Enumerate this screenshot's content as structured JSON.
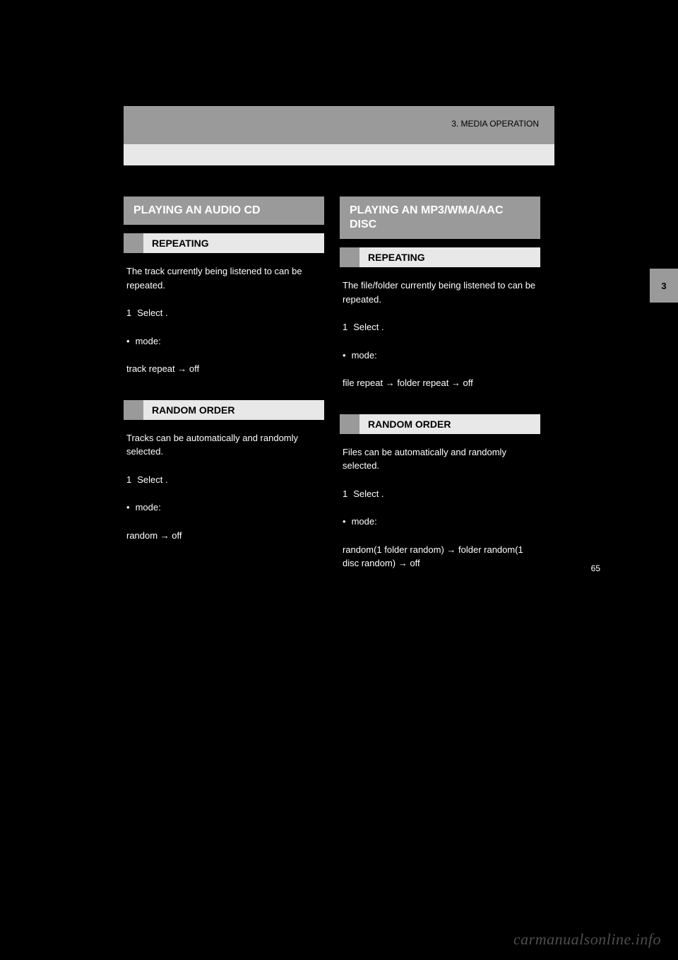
{
  "breadcrumb": "3. MEDIA OPERATION",
  "side_tab": "3",
  "page_number": "65",
  "left": {
    "title": "PLAYING AN AUDIO CD",
    "repeat": {
      "heading": "REPEATING",
      "lead": "The track currently being listened to can be repeated.",
      "item": "Select       .",
      "mode_label": "mode:",
      "mode_value": "track repeat → off"
    },
    "random": {
      "heading": "RANDOM ORDER",
      "lead": "Tracks can be automatically and randomly selected.",
      "item": "Select       .",
      "mode_label": "mode:",
      "mode_value": "random → off"
    }
  },
  "right": {
    "title": "PLAYING AN MP3/WMA/AAC DISC",
    "repeat": {
      "heading": "REPEATING",
      "lead": "The file/folder currently being listened to can be repeated.",
      "item": "Select       .",
      "mode_label": "mode:",
      "mode_value": "file repeat → folder repeat → off"
    },
    "random": {
      "heading": "RANDOM ORDER",
      "lead": "Files can be automatically and randomly selected.",
      "item": "Select       .",
      "mode_label": "mode:",
      "mode_value": "random(1 folder random) → folder random(1 disc random) → off"
    }
  },
  "watermark": "carmanualsonline.info"
}
